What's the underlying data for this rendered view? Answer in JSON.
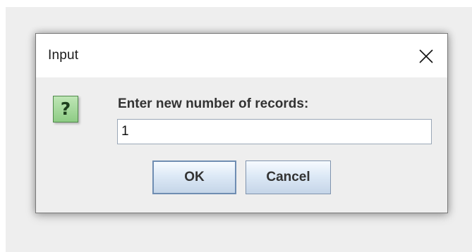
{
  "dialog": {
    "title": "Input",
    "close_icon": "close-icon",
    "question_icon": "question-icon",
    "question_glyph": "?",
    "prompt": "Enter new number of records:",
    "input_value": "1",
    "ok_label": "OK",
    "cancel_label": "Cancel"
  },
  "colors": {
    "background": "#eeeeee",
    "titlebar": "#ffffff",
    "icon_green": "#8ecc85",
    "button_border": "#7f93ad"
  }
}
